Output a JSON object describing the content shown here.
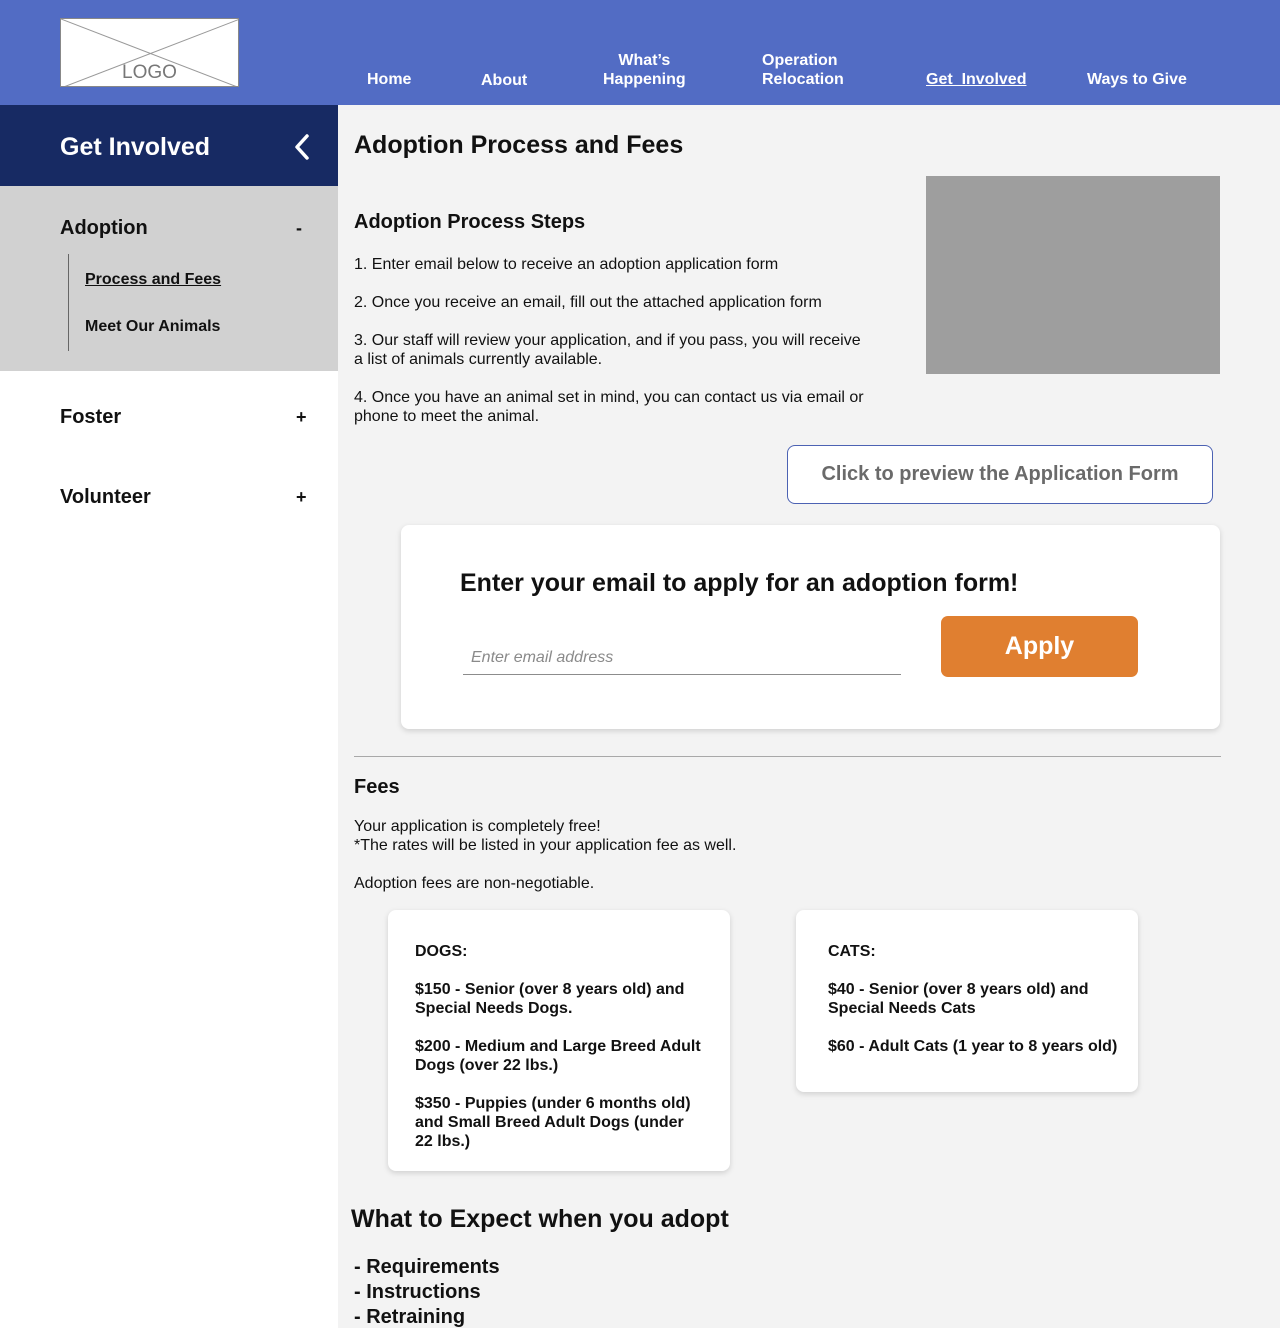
{
  "header": {
    "logo_text": "LOGO",
    "nav": {
      "home": "Home",
      "about": "About",
      "whats_happening_1": "What’s",
      "whats_happening_2": "Happening",
      "operation_relocation_1": "Operation",
      "operation_relocation_2": "Relocation",
      "get_involved": "Get  Involved",
      "ways_to_give": "Ways to Give"
    },
    "active_nav": "Get  Involved",
    "bar_color": "#526cc4"
  },
  "sidebar": {
    "title": "Get Involved",
    "back_icon": "chevron-left-icon",
    "sections": {
      "adoption": {
        "label": "Adoption",
        "toggle": "-",
        "subitems": {
          "process": "Process and Fees",
          "animals": "Meet Our Animals"
        }
      },
      "foster": {
        "label": "Foster",
        "toggle": "+"
      },
      "volunteer": {
        "label": "Volunteer",
        "toggle": "+"
      }
    },
    "header_color": "#172a63"
  },
  "main": {
    "title": "Adoption Process and Fees",
    "steps_heading": "Adoption Process Steps",
    "steps": {
      "s1": "1. Enter email below to receive an adoption application form",
      "s2": "2. Once you receive an email, fill out the attached application form",
      "s3a": "3. Our staff will review your application, and if you pass, you will receive",
      "s3b": "a list of animals currently available.",
      "s4a": "4. Once you have an animal set in mind, you can contact us via email or",
      "s4b": "phone to meet the animal."
    },
    "preview_button": "Click to preview the Application Form",
    "email_card": {
      "title": "Enter your email to apply for an adoption form!",
      "placeholder": "Enter email address",
      "value": "",
      "apply": "Apply",
      "apply_color": "#e07f30"
    },
    "fees": {
      "heading": "Fees",
      "line1": "Your application is completely free!",
      "line2": "*The rates will be listed in your application fee as well.",
      "line3": "Adoption fees are non-negotiable.",
      "dogs": {
        "title": "DOGS:",
        "a1": "$150 - Senior (over 8 years old) and",
        "a2": "Special Needs Dogs.",
        "b1": "$200 - Medium and Large Breed Adult",
        "b2": "Dogs (over 22 lbs.)",
        "c1": "$350 - Puppies (under 6 months old)",
        "c2": "and Small Breed Adult Dogs (under",
        "c3": "22 lbs.)"
      },
      "cats": {
        "title": "CATS:",
        "a1": "$40 - Senior (over 8 years old) and",
        "a2": "Special Needs Cats",
        "b1": "$60 - Adult Cats (1 year to 8 years old)"
      }
    },
    "expect": {
      "title": "What to Expect when you adopt",
      "items": [
        "- Requirements",
        "- Instructions",
        "- Retraining"
      ]
    }
  }
}
